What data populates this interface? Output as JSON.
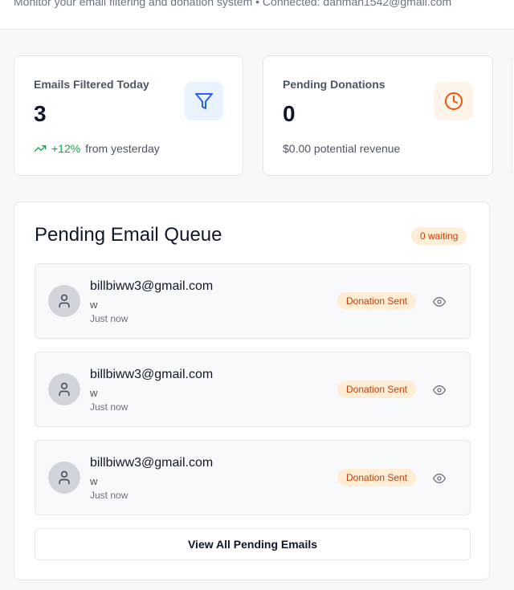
{
  "header": {
    "subtitle": "Monitor your email filtering and donation system • Connected: danman1542@gmail.com"
  },
  "stats": [
    {
      "label": "Emails Filtered Today",
      "value": "3",
      "trend": "+12%",
      "trend_suffix": "from yesterday",
      "icon": "filter-icon",
      "icon_color": "#2563eb"
    },
    {
      "label": "Pending Donations",
      "value": "0",
      "footnote": "$0.00 potential revenue",
      "icon": "clock-icon",
      "icon_color": "#ea580c"
    }
  ],
  "queue": {
    "title": "Pending Email Queue",
    "waiting_badge": "0 waiting",
    "items": [
      {
        "sender": "billbiww3@gmail.com",
        "subject": "w",
        "time": "Just now",
        "status": "Donation Sent"
      },
      {
        "sender": "billbiww3@gmail.com",
        "subject": "w",
        "time": "Just now",
        "status": "Donation Sent"
      },
      {
        "sender": "billbiww3@gmail.com",
        "subject": "w",
        "time": "Just now",
        "status": "Donation Sent"
      }
    ],
    "view_all_label": "View All Pending Emails"
  },
  "colors": {
    "accent_blue": "#2563eb",
    "accent_orange": "#ea580c",
    "success_green": "#16a34a",
    "badge_bg": "#ffedd5",
    "badge_text": "#c2410c"
  }
}
